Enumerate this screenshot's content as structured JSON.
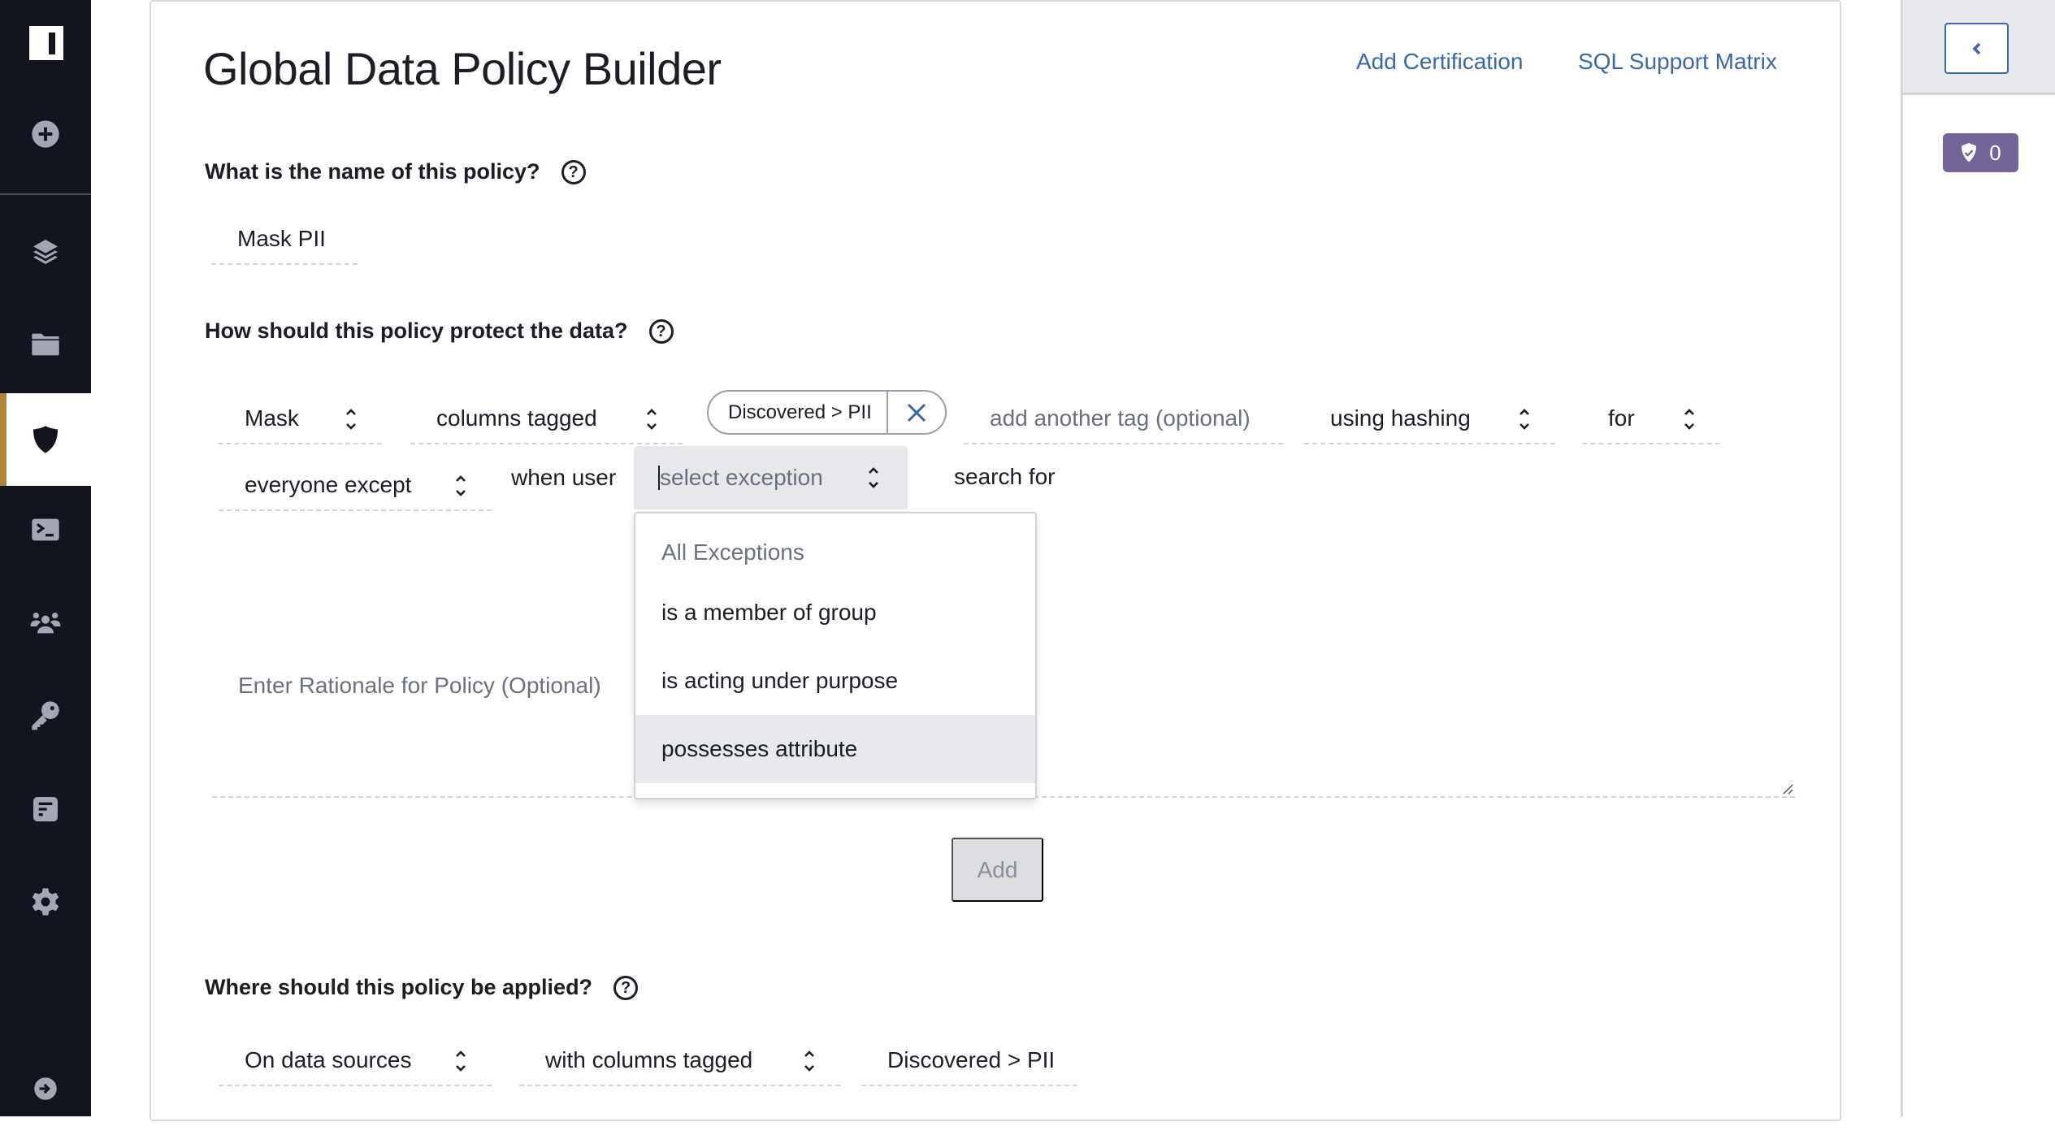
{
  "sidebar": {
    "logo": "I",
    "items": [
      {
        "name": "add",
        "icon": "plus-circle-icon",
        "active": false
      },
      {
        "name": "data-sources",
        "icon": "layers-icon",
        "active": false
      },
      {
        "name": "projects",
        "icon": "folder-icon",
        "active": false
      },
      {
        "name": "policies",
        "icon": "shield-icon",
        "active": true
      },
      {
        "name": "query-editor",
        "icon": "terminal-icon",
        "active": false
      },
      {
        "name": "users",
        "icon": "users-icon",
        "active": false
      },
      {
        "name": "api-keys",
        "icon": "key-icon",
        "active": false
      },
      {
        "name": "audit",
        "icon": "document-icon",
        "active": false
      },
      {
        "name": "settings",
        "icon": "gear-icon",
        "active": false
      },
      {
        "name": "sign-out",
        "icon": "arrow-right-circle-icon",
        "active": false
      }
    ]
  },
  "header": {
    "title": "Global Data Policy Builder",
    "links": [
      "Add Certification",
      "SQL Support Matrix"
    ]
  },
  "policy_name": {
    "question": "What is the name of this policy?",
    "value": "Mask PII"
  },
  "protection": {
    "question": "How should this policy protect the data?",
    "action": "Mask",
    "target": "columns tagged",
    "tags": [
      "Discovered > PII"
    ],
    "add_tag_placeholder": "add another tag (optional)",
    "method": "using hashing",
    "for_label": "for",
    "scope": "everyone except",
    "when_user_label": "when user",
    "exception_placeholder": "select exception",
    "search_placeholder": "search for",
    "exception_menu": {
      "header": "All Exceptions",
      "options": [
        "is a member of group",
        "is acting under purpose",
        "possesses attribute"
      ],
      "highlighted": "possesses attribute"
    },
    "rationale_placeholder": "Enter Rationale for Policy (Optional)",
    "add_button": "Add"
  },
  "application": {
    "question": "Where should this policy be applied?",
    "where": "On data sources",
    "condition": "with columns tagged",
    "tag": "Discovered > PII"
  },
  "right_panel": {
    "certification_count": "0",
    "badge_color": "#736496"
  },
  "colors": {
    "sidebar_bg": "#12151d",
    "active_accent": "#b08438",
    "link": "#3a67a6"
  }
}
